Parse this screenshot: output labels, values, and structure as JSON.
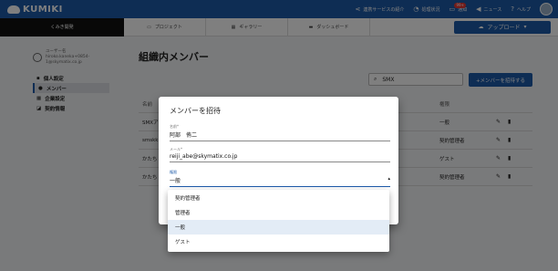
{
  "topbar": {
    "logo": "KUMIKI",
    "nav": [
      {
        "icon": "share-icon",
        "glyph": "⋖",
        "label": "連携サービスの紹介"
      },
      {
        "icon": "bell-icon",
        "glyph": "◔",
        "label": "処理状況"
      },
      {
        "icon": "notification-icon",
        "glyph": "▭",
        "label": "通知",
        "badge": "99+"
      },
      {
        "icon": "megaphone-icon",
        "glyph": "◀",
        "label": "ニュース"
      },
      {
        "icon": "help-icon",
        "glyph": "?",
        "label": "ヘルプ"
      }
    ]
  },
  "subbar": {
    "org": "くみき開発",
    "tabs": [
      {
        "icon": "folder-icon",
        "glyph": "▭",
        "label": "プロジェクト"
      },
      {
        "icon": "gallery-icon",
        "glyph": "▦",
        "label": "ギャラリー"
      },
      {
        "icon": "dashboard-icon",
        "glyph": "▬",
        "label": "ダッシュボード"
      }
    ],
    "upload": "アップロード"
  },
  "sidebar": {
    "user_name_label": "ユーザー名",
    "user_email_1": "hiroko.kaneka+0854-",
    "user_email_2": "1@skymatix.co.jp",
    "items": [
      {
        "icon": "person-icon",
        "glyph": "▪",
        "label": "個人設定",
        "active": false
      },
      {
        "icon": "members-icon",
        "glyph": "●",
        "label": "メンバー",
        "active": true
      },
      {
        "icon": "company-icon",
        "glyph": "▦",
        "label": "企業設定",
        "active": false
      },
      {
        "icon": "contract-icon",
        "glyph": "◪",
        "label": "契約情報",
        "active": false
      }
    ]
  },
  "main": {
    "title": "組織内メンバー",
    "search_value": "SMX",
    "add_button": "+メンバーを招待する",
    "table": {
      "header": {
        "name": "名前",
        "role": "権限"
      },
      "rows": [
        {
          "name": "SMXア",
          "role": "一般"
        },
        {
          "name": "smskk",
          "role": "契約管理者"
        },
        {
          "name": "かたち",
          "role": "ゲスト"
        },
        {
          "name": "かたち",
          "role": "契約管理者"
        }
      ]
    }
  },
  "dialog": {
    "title": "メンバーを招待",
    "name_label": "名前*",
    "name_value": "阿部　侑二",
    "email_label": "メール*",
    "email_value": "reiji_abe@skymatix.co.jp",
    "role_label": "権限",
    "role_value": "一般",
    "options": [
      "契約管理者",
      "管理者",
      "一般",
      "ゲスト"
    ],
    "selected_option": "一般"
  },
  "colors": {
    "primary": "#1d5aa8",
    "dark": "#111111"
  }
}
